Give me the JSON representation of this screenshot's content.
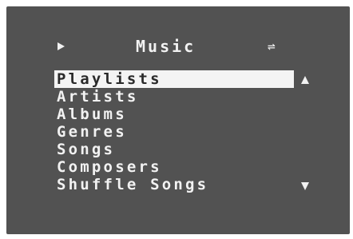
{
  "colors": {
    "screen_background": "#525252",
    "text": "#f2f2f2",
    "highlight_background": "#f4f4f4",
    "highlight_text": "#2a2a2a"
  },
  "header": {
    "play_icon": "play-icon",
    "title": "Music",
    "shuffle_icon": "shuffle-icon",
    "shuffle_glyph": "⇌"
  },
  "menu": {
    "selected_index": 0,
    "items": [
      {
        "label": "Playlists"
      },
      {
        "label": "Artists"
      },
      {
        "label": "Albums"
      },
      {
        "label": "Genres"
      },
      {
        "label": "Songs"
      },
      {
        "label": "Composers"
      },
      {
        "label": "Shuffle Songs"
      }
    ]
  },
  "scroll_indicators": {
    "up_icon": "triangle-up-icon",
    "down_icon": "triangle-down-icon"
  }
}
